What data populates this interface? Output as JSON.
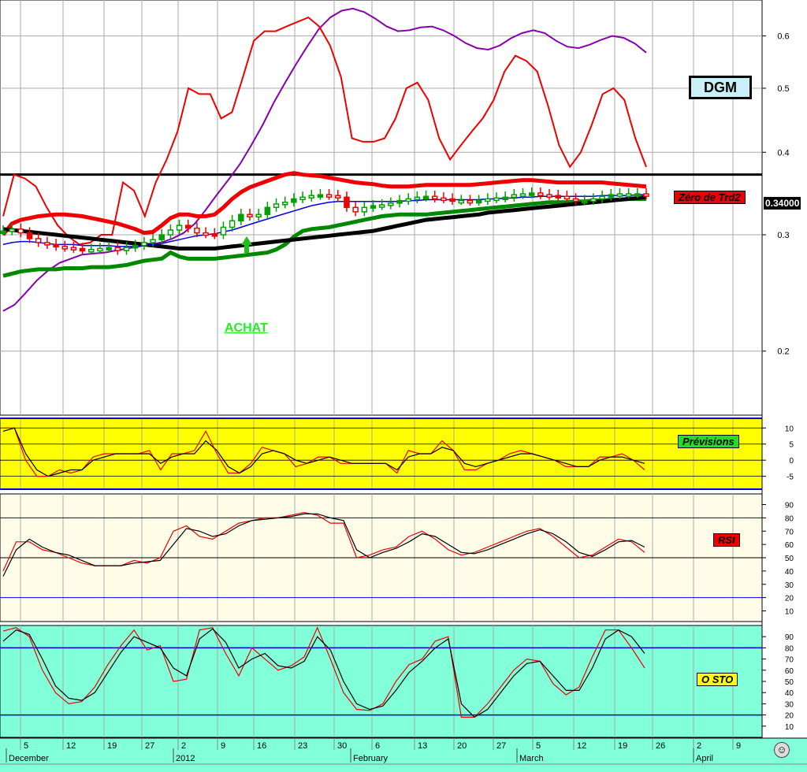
{
  "ticker": "DGM",
  "signal_text": "ACHAT",
  "labels": {
    "zero_trend": "Zéro de Trd2",
    "previsions": "Prévisions",
    "rsi": "RSI",
    "osto": "O STO",
    "last_price": "0.34000"
  },
  "colors": {
    "price_up": "#00a000",
    "price_down": "#ee0000",
    "upper_band": "#ee0000",
    "lower_band": "#008800",
    "mid_band": "#000000",
    "ma": "#0000dd",
    "purple": "#8800aa",
    "prev_bg": "#ffff00",
    "rsi_bg": "#fffde8",
    "osto_bg": "#80ffd8",
    "bottom_bar": "#80ffd8"
  },
  "icons": {
    "smiley": "smiley-icon"
  },
  "chart_data": [
    {
      "type": "candlestick",
      "title": "DGM",
      "scale": "log",
      "ylim": [
        0.16,
        0.68
      ],
      "yticks": [
        "0.6",
        "0.5",
        "0.4",
        "0.3",
        "0.2"
      ],
      "x_day_labels": [
        "5",
        "12",
        "19",
        "27",
        "2",
        "9",
        "16",
        "23",
        "30",
        "6",
        "13",
        "20",
        "27",
        "5",
        "12",
        "19",
        "26",
        "2",
        "9"
      ],
      "x_month_labels": [
        "December",
        "2012",
        "February",
        "March",
        "April"
      ],
      "reference_level": 0.37,
      "last_price": 0.34,
      "closes": [
        0.304,
        0.306,
        0.302,
        0.296,
        0.292,
        0.29,
        0.288,
        0.287,
        0.286,
        0.285,
        0.285,
        0.286,
        0.287,
        0.284,
        0.287,
        0.289,
        0.292,
        0.295,
        0.3,
        0.305,
        0.31,
        0.307,
        0.302,
        0.301,
        0.3,
        0.308,
        0.315,
        0.322,
        0.32,
        0.322,
        0.33,
        0.334,
        0.336,
        0.34,
        0.342,
        0.344,
        0.345,
        0.344,
        0.342,
        0.33,
        0.325,
        0.33,
        0.332,
        0.333,
        0.335,
        0.338,
        0.34,
        0.342,
        0.343,
        0.341,
        0.34,
        0.338,
        0.338,
        0.337,
        0.338,
        0.34,
        0.341,
        0.342,
        0.345,
        0.346,
        0.347,
        0.345,
        0.344,
        0.343,
        0.34,
        0.338,
        0.338,
        0.34,
        0.343,
        0.345,
        0.346,
        0.346,
        0.346,
        0.345
      ],
      "series": [
        {
          "name": "upper",
          "values": [
            0.3,
            0.312,
            0.316,
            0.318,
            0.32,
            0.321,
            0.322,
            0.322,
            0.321,
            0.32,
            0.318,
            0.316,
            0.314,
            0.312,
            0.309,
            0.306,
            0.302,
            0.303,
            0.31,
            0.318,
            0.322,
            0.322,
            0.32,
            0.32,
            0.322,
            0.33,
            0.34,
            0.348,
            0.354,
            0.358,
            0.362,
            0.366,
            0.37,
            0.372,
            0.37,
            0.369,
            0.368,
            0.366,
            0.364,
            0.362,
            0.36,
            0.359,
            0.358,
            0.356,
            0.355,
            0.355,
            0.355,
            0.356,
            0.357,
            0.357,
            0.357,
            0.357,
            0.357,
            0.357,
            0.358,
            0.359,
            0.36,
            0.361,
            0.362,
            0.363,
            0.363,
            0.362,
            0.361,
            0.36,
            0.36,
            0.36,
            0.36,
            0.36,
            0.36,
            0.359,
            0.358,
            0.357,
            0.356,
            0.355
          ]
        },
        {
          "name": "mid",
          "values": [
            0.306,
            0.305,
            0.304,
            0.303,
            0.302,
            0.301,
            0.3,
            0.299,
            0.298,
            0.297,
            0.296,
            0.295,
            0.294,
            0.293,
            0.292,
            0.291,
            0.29,
            0.289,
            0.288,
            0.287,
            0.286,
            0.286,
            0.286,
            0.286,
            0.286,
            0.287,
            0.288,
            0.289,
            0.29,
            0.291,
            0.292,
            0.293,
            0.294,
            0.295,
            0.296,
            0.297,
            0.298,
            0.299,
            0.3,
            0.301,
            0.302,
            0.303,
            0.304,
            0.306,
            0.308,
            0.31,
            0.312,
            0.314,
            0.316,
            0.317,
            0.318,
            0.319,
            0.32,
            0.321,
            0.322,
            0.324,
            0.325,
            0.326,
            0.327,
            0.328,
            0.329,
            0.33,
            0.331,
            0.332,
            0.333,
            0.334,
            0.335,
            0.336,
            0.337,
            0.338,
            0.339,
            0.34,
            0.341,
            0.342
          ]
        },
        {
          "name": "lower",
          "values": [
            0.26,
            0.262,
            0.264,
            0.265,
            0.266,
            0.266,
            0.266,
            0.267,
            0.267,
            0.267,
            0.268,
            0.268,
            0.268,
            0.269,
            0.27,
            0.272,
            0.274,
            0.275,
            0.276,
            0.282,
            0.278,
            0.276,
            0.276,
            0.276,
            0.276,
            0.277,
            0.278,
            0.279,
            0.28,
            0.281,
            0.282,
            0.285,
            0.29,
            0.298,
            0.304,
            0.306,
            0.307,
            0.308,
            0.31,
            0.312,
            0.314,
            0.316,
            0.318,
            0.32,
            0.321,
            0.322,
            0.322,
            0.322,
            0.322,
            0.323,
            0.324,
            0.325,
            0.326,
            0.327,
            0.328,
            0.329,
            0.33,
            0.331,
            0.332,
            0.333,
            0.334,
            0.335,
            0.336,
            0.336,
            0.336,
            0.337,
            0.337,
            0.338,
            0.338,
            0.339,
            0.339,
            0.34,
            0.34,
            0.34
          ]
        },
        {
          "name": "ma",
          "values": [
            0.29,
            0.292,
            0.293,
            0.293,
            0.292,
            0.291,
            0.29,
            0.29,
            0.29,
            0.289,
            0.289,
            0.289,
            0.289,
            0.288,
            0.288,
            0.288,
            0.289,
            0.29,
            0.291,
            0.293,
            0.295,
            0.297,
            0.299,
            0.3,
            0.301,
            0.303,
            0.305,
            0.308,
            0.311,
            0.314,
            0.317,
            0.32,
            0.323,
            0.326,
            0.329,
            0.332,
            0.334,
            0.336,
            0.337,
            0.337,
            0.337,
            0.337,
            0.337,
            0.337,
            0.337,
            0.337,
            0.338,
            0.338,
            0.339,
            0.339,
            0.339,
            0.339,
            0.339,
            0.339,
            0.339,
            0.34,
            0.34,
            0.341,
            0.341,
            0.342,
            0.342,
            0.343,
            0.343,
            0.343,
            0.343,
            0.343,
            0.343,
            0.343,
            0.344,
            0.344,
            0.344,
            0.344,
            0.345,
            0.345
          ]
        },
        {
          "name": "red_thin",
          "values": [
            0.32,
            0.37,
            0.365,
            0.355,
            0.33,
            0.31,
            0.298,
            0.29,
            0.292,
            0.3,
            0.3,
            0.36,
            0.35,
            0.32,
            0.36,
            0.39,
            0.43,
            0.5,
            0.49,
            0.49,
            0.45,
            0.46,
            0.52,
            0.59,
            0.61,
            0.61,
            0.62,
            0.63,
            0.64,
            0.62,
            0.58,
            0.52,
            0.42,
            0.415,
            0.415,
            0.42,
            0.45,
            0.5,
            0.51,
            0.48,
            0.42,
            0.39,
            0.41,
            0.43,
            0.45,
            0.48,
            0.53,
            0.56,
            0.55,
            0.53,
            0.47,
            0.41,
            0.38,
            0.4,
            0.44,
            0.49,
            0.5,
            0.48,
            0.42,
            0.38
          ]
        },
        {
          "name": "purple",
          "values": [
            0.23,
            0.235,
            0.245,
            0.256,
            0.265,
            0.272,
            0.276,
            0.28,
            0.281,
            0.282,
            0.284,
            0.286,
            0.288,
            0.29,
            0.292,
            0.296,
            0.302,
            0.312,
            0.328,
            0.346,
            0.364,
            0.384,
            0.41,
            0.44,
            0.476,
            0.51,
            0.545,
            0.58,
            0.615,
            0.64,
            0.655,
            0.66,
            0.652,
            0.637,
            0.62,
            0.61,
            0.612,
            0.618,
            0.62,
            0.612,
            0.6,
            0.585,
            0.575,
            0.572,
            0.58,
            0.595,
            0.606,
            0.612,
            0.606,
            0.59,
            0.578,
            0.575,
            0.582,
            0.592,
            0.6,
            0.596,
            0.584,
            0.566
          ]
        }
      ]
    },
    {
      "type": "line",
      "title": "Prévisions",
      "ylim": [
        -9,
        13
      ],
      "yticks": [
        "10",
        "5",
        "0",
        "-5"
      ],
      "series": [
        {
          "name": "red",
          "values": [
            10,
            10,
            0,
            -5,
            -5,
            -3,
            -4,
            -3,
            1,
            2,
            2,
            2,
            2,
            3,
            -3,
            2,
            2,
            3,
            9,
            2,
            -4,
            -4,
            -1,
            4,
            3,
            2,
            -2,
            -1,
            1,
            1,
            -1,
            -1,
            -1,
            -1,
            -1,
            -4,
            3,
            2,
            2,
            6,
            3,
            -3,
            -3,
            -1,
            0,
            2,
            3,
            2,
            1,
            0,
            -2,
            -2,
            -2,
            1,
            1,
            2,
            0,
            -3
          ]
        },
        {
          "name": "black",
          "values": [
            9,
            10,
            2,
            -3,
            -5,
            -4,
            -3,
            -3,
            0,
            1,
            2,
            2,
            2,
            2,
            -1,
            1,
            2,
            2,
            6,
            3,
            -2,
            -4,
            -2,
            2,
            3,
            2,
            0,
            -1,
            0,
            1,
            0,
            -1,
            -1,
            -1,
            -1,
            -3,
            1,
            2,
            2,
            4,
            3,
            -1,
            -2,
            -1,
            0,
            1,
            2,
            2,
            1,
            0,
            -1,
            -2,
            -2,
            0,
            1,
            1,
            0,
            -1
          ]
        }
      ]
    },
    {
      "type": "line",
      "title": "RSI",
      "ylim": [
        2,
        98
      ],
      "yticks": [
        "90",
        "80",
        "70",
        "60",
        "50",
        "40",
        "30",
        "20",
        "10"
      ],
      "reference_lines": [
        80,
        50,
        20
      ],
      "series": [
        {
          "name": "red",
          "values": [
            40,
            62,
            62,
            56,
            54,
            50,
            46,
            44,
            44,
            44,
            48,
            46,
            50,
            70,
            74,
            66,
            64,
            70,
            76,
            78,
            80,
            80,
            82,
            84,
            82,
            76,
            76,
            50,
            52,
            56,
            58,
            66,
            70,
            64,
            56,
            52,
            54,
            58,
            62,
            66,
            70,
            72,
            66,
            58,
            50,
            52,
            58,
            64,
            62,
            54
          ]
        },
        {
          "name": "black",
          "values": [
            36,
            56,
            64,
            58,
            54,
            52,
            48,
            44,
            44,
            44,
            46,
            47,
            48,
            60,
            72,
            70,
            66,
            68,
            74,
            78,
            79,
            80,
            81,
            83,
            83,
            80,
            78,
            56,
            50,
            54,
            57,
            62,
            68,
            66,
            60,
            54,
            53,
            56,
            60,
            64,
            68,
            71,
            68,
            62,
            54,
            51,
            56,
            62,
            63,
            58
          ]
        }
      ]
    },
    {
      "type": "line",
      "title": "O STO",
      "ylim": [
        0,
        100
      ],
      "yticks": [
        "90",
        "80",
        "70",
        "60",
        "50",
        "40",
        "30",
        "20",
        "10"
      ],
      "reference_lines": [
        80,
        20
      ],
      "series": [
        {
          "name": "red",
          "values": [
            95,
            98,
            90,
            60,
            40,
            30,
            32,
            45,
            65,
            82,
            96,
            78,
            82,
            50,
            52,
            96,
            98,
            75,
            55,
            80,
            70,
            60,
            64,
            72,
            98,
            70,
            40,
            25,
            24,
            30,
            50,
            65,
            70,
            86,
            90,
            18,
            18,
            30,
            45,
            60,
            70,
            68,
            48,
            38,
            45,
            72,
            96,
            96,
            80,
            62
          ]
        },
        {
          "name": "black",
          "values": [
            86,
            96,
            92,
            70,
            46,
            35,
            33,
            40,
            58,
            76,
            90,
            85,
            80,
            62,
            55,
            88,
            97,
            85,
            62,
            70,
            75,
            64,
            62,
            68,
            90,
            78,
            50,
            30,
            25,
            28,
            42,
            58,
            68,
            80,
            88,
            30,
            18,
            25,
            40,
            55,
            66,
            68,
            55,
            42,
            42,
            62,
            88,
            96,
            90,
            75
          ]
        }
      ]
    }
  ]
}
